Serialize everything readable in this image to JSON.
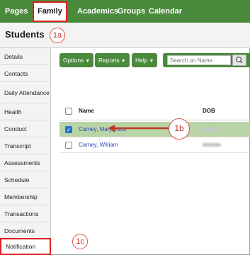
{
  "nav": {
    "tabs": [
      {
        "label": "Pages"
      },
      {
        "label": "Family"
      },
      {
        "label": "Academics"
      },
      {
        "label": "Groups"
      },
      {
        "label": "Calendar"
      }
    ]
  },
  "page": {
    "title": "Students"
  },
  "callouts": {
    "a": "1a",
    "b": "1b",
    "c": "1c"
  },
  "sidebar": {
    "items": [
      {
        "label": "Details"
      },
      {
        "label": "Contacts"
      },
      {
        "label": "Daily Attendance"
      },
      {
        "label": "Health"
      },
      {
        "label": "Conduct"
      },
      {
        "label": "Transcript"
      },
      {
        "label": "Assessments"
      },
      {
        "label": "Schedule"
      },
      {
        "label": "Membership"
      },
      {
        "label": "Transactions"
      },
      {
        "label": "Documents"
      },
      {
        "label": "Notification"
      }
    ]
  },
  "toolbar": {
    "options_label": "Options",
    "reports_label": "Reports",
    "help_label": "Help",
    "search_placeholder": "Search on Name"
  },
  "table": {
    "headers": [
      "Name",
      "DOB"
    ],
    "rows": [
      {
        "name": "Carney, Marygrace",
        "checked": true
      },
      {
        "name": "Carney, William",
        "checked": false
      }
    ]
  },
  "colors": {
    "brand": "#4a8a3c",
    "highlight": "#e02020",
    "selected_row": "#b9d4a6"
  }
}
